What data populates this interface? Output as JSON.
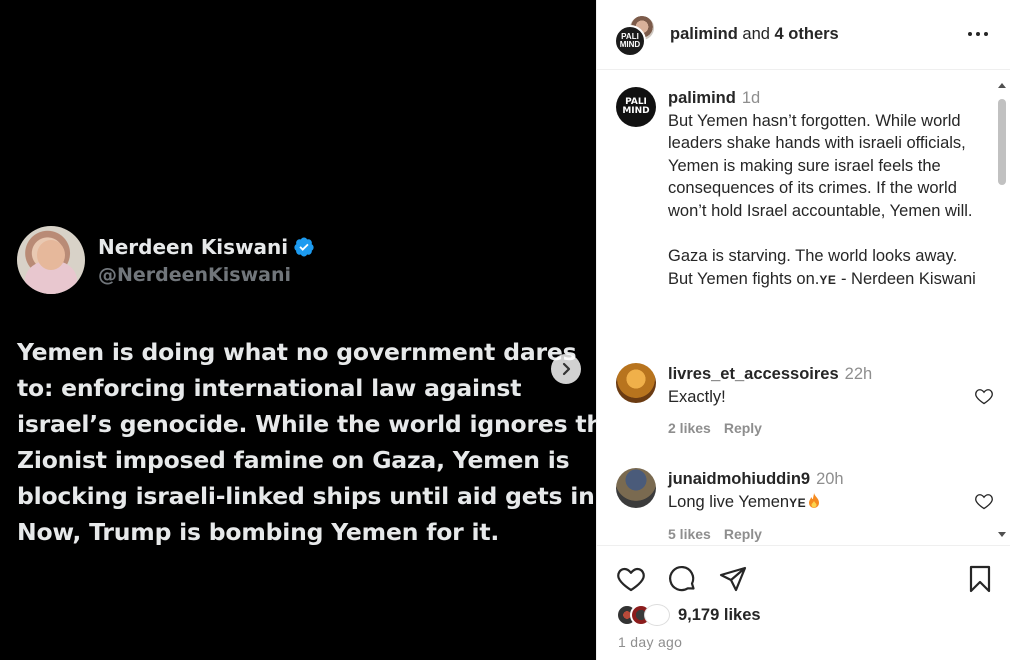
{
  "media": {
    "tweet": {
      "name": "Nerdeen Kiswani",
      "handle": "@NerdeenKiswani",
      "lines": [
        "Yemen is doing what no government dares",
        "to: enforcing international law against",
        "israel’s genocide. While the world ignores the",
        "Zionist imposed famine on Gaza, Yemen is",
        "blocking israeli-linked ships until aid gets in.",
        "Now, Trump is bombing Yemen for it."
      ]
    },
    "next_icon": "chevron-right-icon"
  },
  "header": {
    "user": "palimind",
    "joiner": " and ",
    "others": "4 others",
    "more_icon": "more-horizontal-icon"
  },
  "caption": {
    "avatar_text_1": "PALI",
    "avatar_text_2": "MIND",
    "user": "palimind",
    "time": "1d",
    "text": "But Yemen hasn’t forgotten. While world leaders shake hands with israeli officials, Yemen is making sure israel feels the consequences of its crimes. If the world won’t hold Israel accountable, Yemen will.\n\nGaza is starving. The world looks away. But Yemen fights on.",
    "flag": "YE",
    "suffix": " - Nerdeen Kiswani"
  },
  "comments": [
    {
      "user": "livres_et_accessoires",
      "time": "22h",
      "text": "Exactly!",
      "likes": "2 likes",
      "reply": "Reply"
    },
    {
      "user": "junaidmohiuddin9",
      "time": "20h",
      "text": "Long live Yemen",
      "flag": "YE",
      "likes": "5 likes",
      "reply": "Reply"
    }
  ],
  "footer": {
    "likes": "9,179 likes",
    "ago": "1 day ago",
    "icons": [
      "heart-icon",
      "comment-icon",
      "share-icon",
      "bookmark-icon"
    ]
  },
  "colors": {
    "verified": "#1d9bf0",
    "tweet_text": "#e7e9ea",
    "muted": "#8e8e8e"
  }
}
